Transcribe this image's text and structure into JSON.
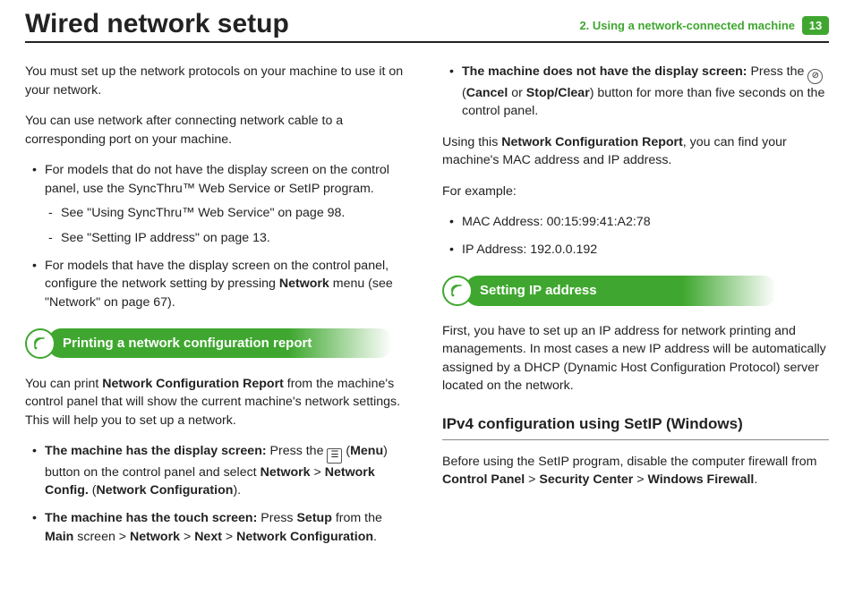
{
  "header": {
    "title": "Wired network setup",
    "chapter": "2.  Using a network-connected machine",
    "pageNumber": "13"
  },
  "left": {
    "intro1": "You must set up the network protocols on your machine to use it on your network.",
    "intro2": "You can use network after connecting network cable to a corresponding port on your machine.",
    "b1_pre": "For models that do not have the display screen on the control panel, use the SyncThru™ Web Service or SetIP program.",
    "b1_d1": "See \"Using SyncThru™ Web Service\" on page 98.",
    "b1_d2": "See \"Setting IP address\" on page 13.",
    "b2_a": "For models that have the display screen on the control panel, configure the network setting by pressing ",
    "b2_b": "Network",
    "b2_c": " menu (see \"Network\" on page 67).",
    "section1": "Printing a network configuration report",
    "s1_p1_a": "You can print ",
    "s1_p1_b": "Network Configuration Report",
    "s1_p1_c": " from the machine's control panel that will show the current machine's network settings. This will help you to set up a network.",
    "s1_b1_a": "The machine has the display screen:",
    "s1_b1_b": " Press the ",
    "s1_b1_menu": "Menu",
    "s1_b1_c": ") button on the control panel and select ",
    "s1_b1_d": "Network",
    "s1_b1_e": "Network Config.",
    "s1_b1_f": "Network Configuration",
    "s1_b2_a": "The machine has the touch screen:",
    "s1_b2_b": " Press ",
    "s1_b2_c": "Setup",
    "s1_b2_d": " from the ",
    "s1_b2_e": "Main",
    "s1_b2_f": " screen > ",
    "s1_b2_g": "Network",
    "s1_b2_h": "Next",
    "s1_b2_i": "Network Configuration"
  },
  "right": {
    "b1_a": "The machine does not have the display screen:",
    "b1_b": " Press the ",
    "b1_c": "Cancel",
    "b1_d": " or ",
    "b1_e": "Stop/Clear",
    "b1_f": ") button for more than five seconds on the control panel.",
    "p2_a": "Using this ",
    "p2_b": "Network Configuration Report",
    "p2_c": ", you can find your machine's MAC address and IP address.",
    "example": "For example:",
    "mac": "MAC Address: 00:15:99:41:A2:78",
    "ip": "IP Address: 192.0.0.192",
    "section2": "Setting IP address",
    "s2_p1": "First, you have to set up an IP address for network printing and managements. In most cases a new IP address will be automatically assigned by a DHCP (Dynamic Host Configuration Protocol) server located on the network.",
    "subhead": "IPv4 configuration using SetIP (Windows)",
    "s2_p2_a": "Before using the SetIP program, disable the computer firewall from ",
    "s2_p2_b": "Control Panel",
    "s2_p2_c": "Security Center",
    "s2_p2_d": "Windows Firewall"
  }
}
